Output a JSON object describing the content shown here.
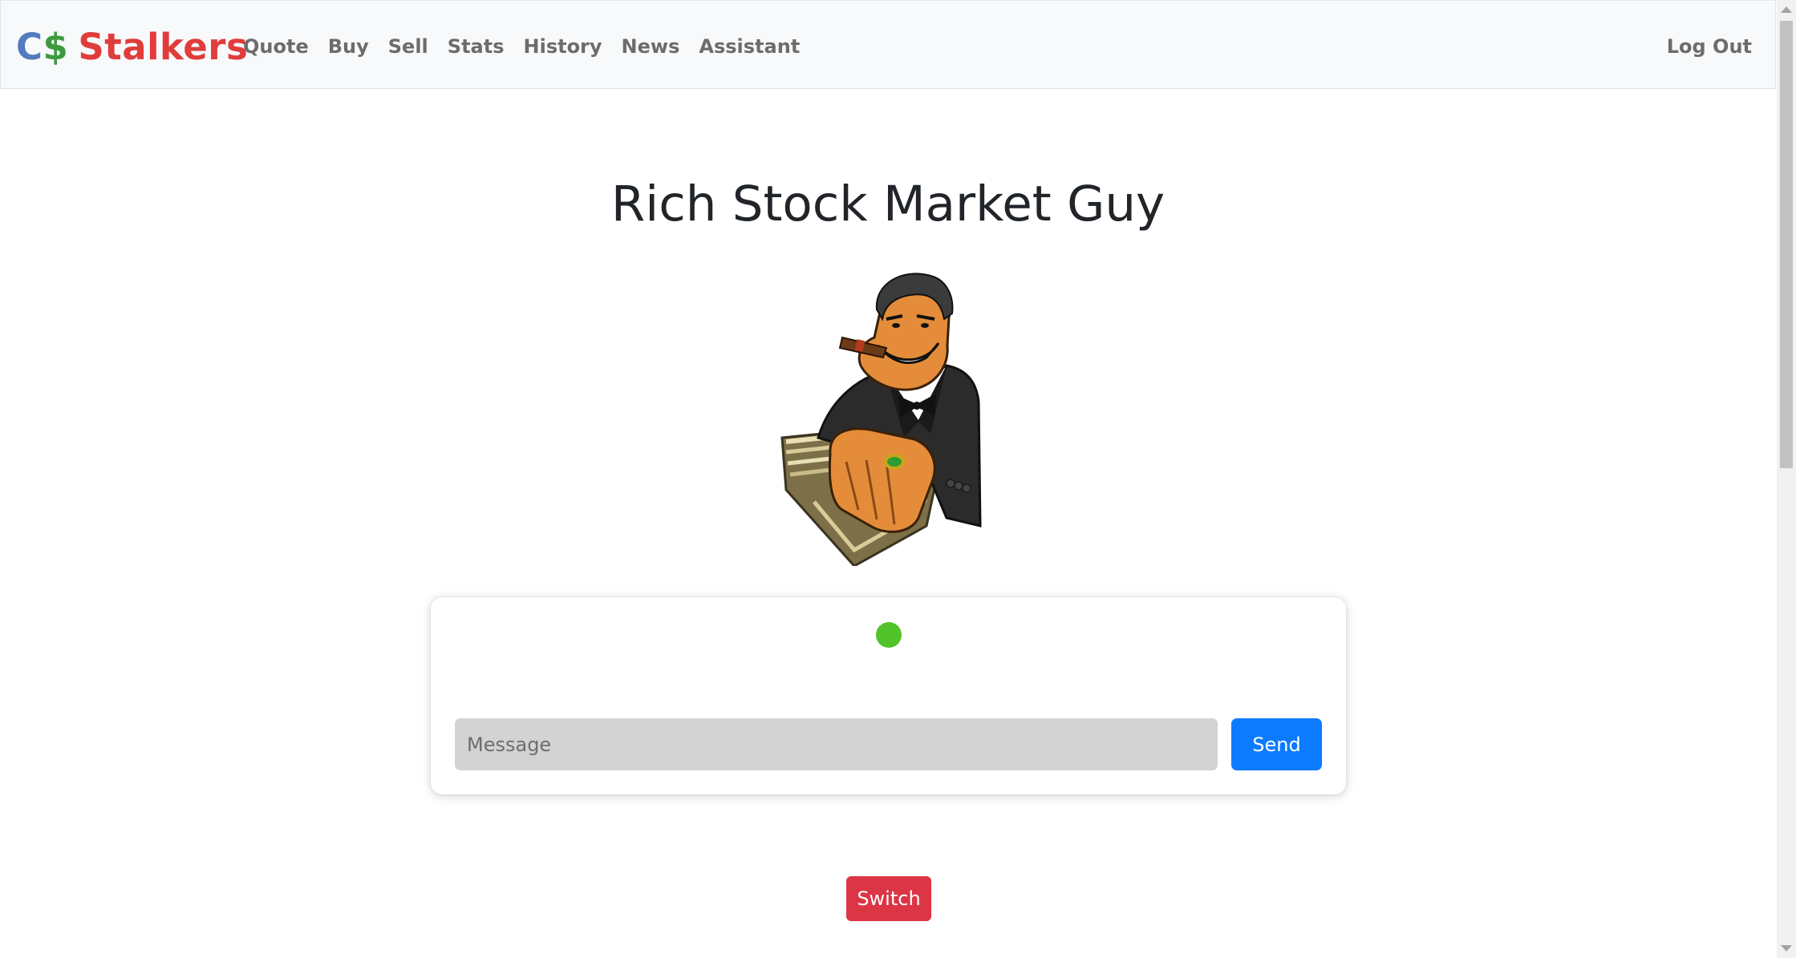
{
  "navbar": {
    "brand": {
      "part1": "C",
      "part2": "$",
      "part3": "Stalkers"
    },
    "links": [
      {
        "label": "Quote"
      },
      {
        "label": "Buy"
      },
      {
        "label": "Sell"
      },
      {
        "label": "Stats"
      },
      {
        "label": "History"
      },
      {
        "label": "News"
      },
      {
        "label": "Assistant"
      }
    ],
    "logout_label": "Log Out"
  },
  "main": {
    "title": "Rich Stock Market Guy",
    "avatar_icon": "rich-man-cartoon-icon"
  },
  "chat": {
    "status_color": "#52c22b",
    "input_value": "",
    "input_placeholder": "Message",
    "send_label": "Send"
  },
  "switch_label": "Switch",
  "colors": {
    "brand_blue": "#537bbf",
    "brand_green": "#3d9b3f",
    "brand_red": "#e03c3c",
    "send_button": "#0d7bff",
    "switch_button": "#dc3545"
  }
}
